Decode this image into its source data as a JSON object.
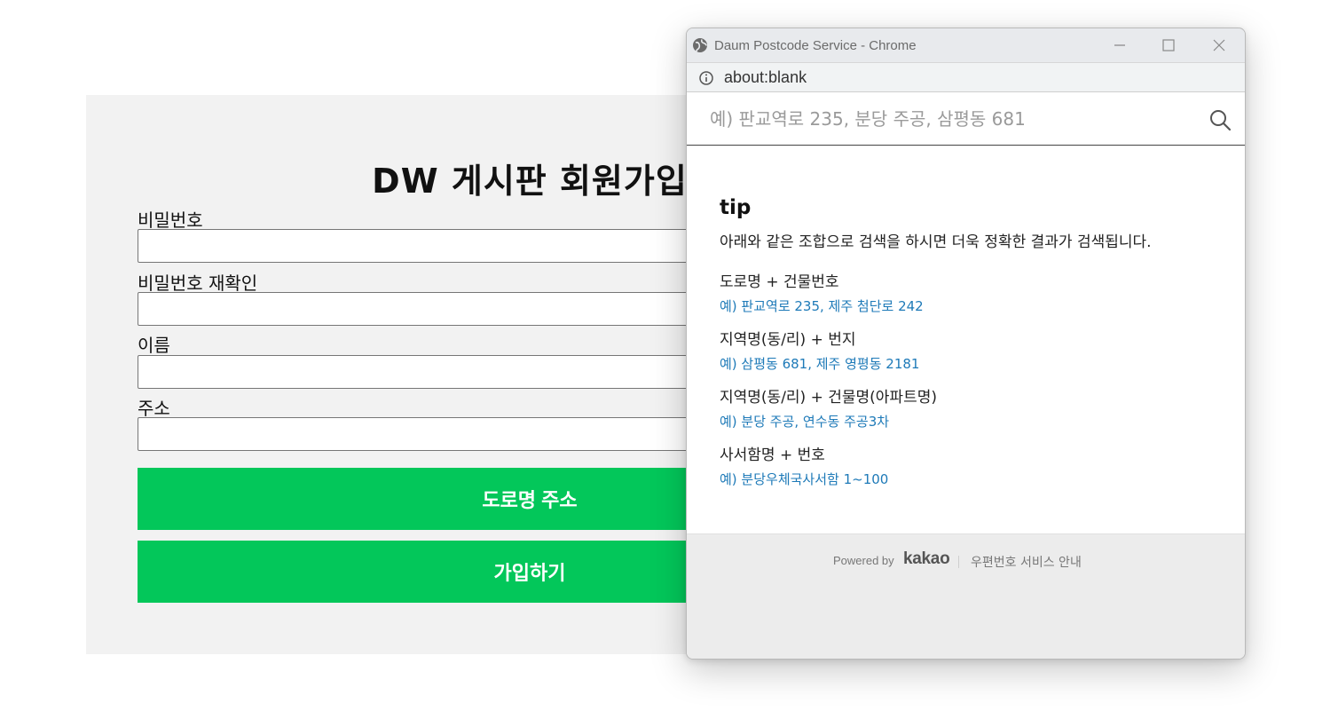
{
  "form": {
    "title": "DW 게시판 회원가입",
    "fields": [
      {
        "label": "비밀번호",
        "value": ""
      },
      {
        "label": "비밀번호 재확인",
        "value": ""
      },
      {
        "label": "이름",
        "value": ""
      },
      {
        "label": "주소",
        "value": ""
      }
    ],
    "address_button": "도로명 주소",
    "signup_button": "가입하기"
  },
  "popup": {
    "window_title": "Daum Postcode Service - Chrome",
    "url": "about:blank",
    "search_placeholder": "예) 판교역로 235, 분당 주공, 삼평동 681",
    "tip": {
      "title": "tip",
      "description": "아래와 같은 조합으로 검색을 하시면 더욱 정확한 결과가 검색됩니다.",
      "items": [
        {
          "label": "도로명 + 건물번호",
          "example": "예) 판교역로 235,  제주 첨단로 242"
        },
        {
          "label": "지역명(동/리) + 번지",
          "example": "예) 삼평동 681,  제주 영평동 2181"
        },
        {
          "label": "지역명(동/리) + 건물명(아파트명)",
          "example": "예) 분당 주공,  연수동 주공3차"
        },
        {
          "label": "사서함명 + 번호",
          "example": "예) 분당우체국사서함 1~100"
        }
      ]
    },
    "footer": {
      "powered_by": "Powered by",
      "logo_text": "kakao",
      "service_link": "우편번호 서비스 안내"
    }
  },
  "colors": {
    "accent_green": "#03c75a",
    "example_blue": "#1e7ab8",
    "form_bg": "#f2f2f2"
  }
}
